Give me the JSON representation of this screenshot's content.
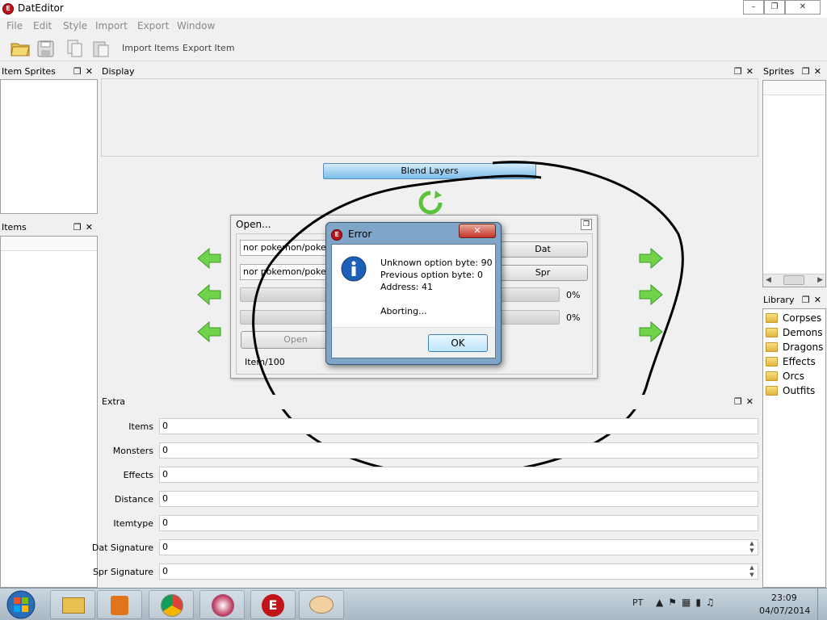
{
  "window": {
    "title": "DatEditor"
  },
  "menu": {
    "items": [
      "File",
      "Edit",
      "Style",
      "Import",
      "Export",
      "Window"
    ]
  },
  "toolbar": {
    "import_items": "Import Items",
    "export_item": "Export Item"
  },
  "docks": {
    "item_sprites": "Item Sprites",
    "items": "Items",
    "display": "Display",
    "sprites": "Sprites",
    "library": "Library",
    "extra": "Extra"
  },
  "display": {
    "blend_layers": "Blend Layers"
  },
  "open_dialog": {
    "title": "Open...",
    "dat_path": "nor pokemon/poke cha",
    "spr_path": "nor pokemon/poke cha",
    "dat_button": "Dat",
    "spr_button": "Spr",
    "progress1": "0%",
    "progress2": "0%",
    "open_button": "Open",
    "status": "Item/100"
  },
  "error_dialog": {
    "title": "Error",
    "line1": "Unknown option byte: 90",
    "line2": "Previous option byte: 0",
    "line3": "Address: 41",
    "line4": "Aborting...",
    "ok": "OK"
  },
  "library": {
    "items": [
      "Corpses",
      "Demons",
      "Dragons",
      "Effects",
      "Orcs",
      "Outfits"
    ]
  },
  "extra": {
    "rows": [
      {
        "label": "Items",
        "value": "0"
      },
      {
        "label": "Monsters",
        "value": "0"
      },
      {
        "label": "Effects",
        "value": "0"
      },
      {
        "label": "Distance",
        "value": "0"
      },
      {
        "label": "Itemtype",
        "value": "0"
      },
      {
        "label": "Dat Signature",
        "value": "0"
      },
      {
        "label": "Spr Signature",
        "value": "0"
      }
    ]
  },
  "taskbar": {
    "lang": "PT",
    "time": "23:09",
    "date": "04/07/2014"
  },
  "colors": {
    "accent_green": "#5bc33a",
    "error_red": "#c0141a",
    "info_blue": "#1e5fb8"
  }
}
